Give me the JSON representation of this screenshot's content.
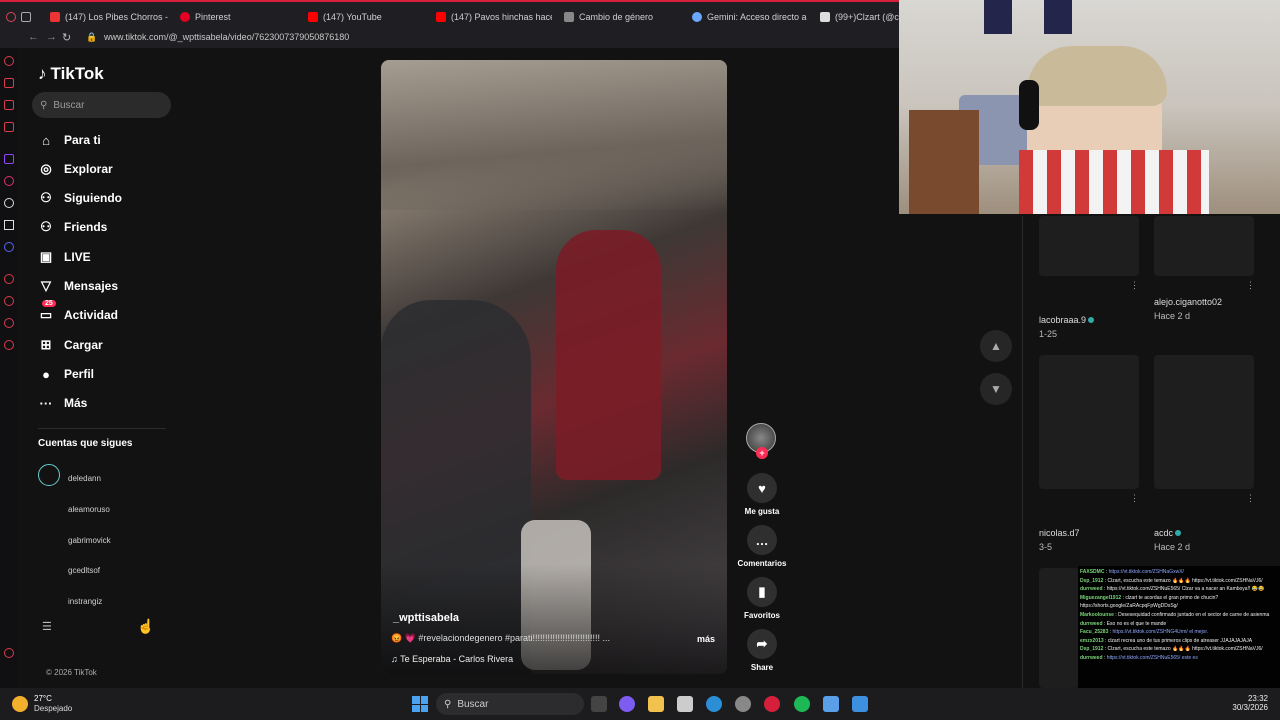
{
  "browser": {
    "tabs": [
      {
        "label": "(147) Los Pibes Chorros -",
        "color": "#e33"
      },
      {
        "label": "Pinterest",
        "color": "#e60023"
      },
      {
        "label": "(147) YouTube",
        "color": "#f00"
      },
      {
        "label": "(147) Pavos hinchas hace",
        "color": "#f00"
      },
      {
        "label": "Cambio de género",
        "color": "#888"
      },
      {
        "label": "Gemini: Acceso directo a",
        "color": "#6aa7ff"
      },
      {
        "label": "(99+)Clzart (@cl",
        "color": "#ddd"
      }
    ],
    "url": "www.tiktok.com/@_wpttisabela/video/7623007379050876180"
  },
  "tiktok": {
    "logo": "TikTok",
    "search_placeholder": "Buscar",
    "nav": [
      {
        "label": "Para ti",
        "icon": "home-icon",
        "glyph": "⌂"
      },
      {
        "label": "Explorar",
        "icon": "compass-icon",
        "glyph": "◎"
      },
      {
        "label": "Siguiendo",
        "icon": "following-icon",
        "glyph": "⚇"
      },
      {
        "label": "Friends",
        "icon": "friends-icon",
        "glyph": "⚇"
      },
      {
        "label": "LIVE",
        "icon": "live-icon",
        "glyph": "▣"
      },
      {
        "label": "Mensajes",
        "icon": "messages-icon",
        "glyph": "▽"
      },
      {
        "label": "Actividad",
        "icon": "activity-icon",
        "glyph": "▭",
        "badge": "25"
      },
      {
        "label": "Cargar",
        "icon": "upload-icon",
        "glyph": "⊞"
      },
      {
        "label": "Perfil",
        "icon": "profile-icon",
        "glyph": "●"
      },
      {
        "label": "Más",
        "icon": "more-icon",
        "glyph": "···"
      }
    ],
    "following_title": "Cuentas que sigues",
    "following": [
      "deledann",
      "aleamoruso",
      "gabrimovick",
      "gcedltsof",
      "instrangiz"
    ],
    "copyright": "© 2026 TikTok"
  },
  "video": {
    "username": "_wpttisabela",
    "description": "😡 💗 #revelaciondegenero #parati!!!!!!!!!!!!!!!!!!!!!!!!!!! ...",
    "more": "más",
    "music": "Te Esperaba - Carlos Rivera",
    "actions": {
      "like": "Me gusta",
      "comment": "Comentarios",
      "favorite": "Favoritos",
      "share": "Share"
    }
  },
  "grid": {
    "row1": [
      {
        "user": "lacobraaa.9",
        "meta": "1-25"
      },
      {
        "user": "alejo.ciganotto02",
        "meta": "Hace 2 d"
      }
    ],
    "row2": [
      {
        "user": "nicolas.d7",
        "meta": "3-5"
      },
      {
        "user": "acdc",
        "meta": "Hace 2 d"
      }
    ]
  },
  "chat": [
    {
      "user": "FAXSDMC",
      "text": "https://vt.tiktok.com/ZSHNaGxwX/"
    },
    {
      "user": "Dsp_1912",
      "text": "Clzart, escucha este temazo 🔥🔥🔥 https://vt.tiktok.com/ZSHNaVJ6/"
    },
    {
      "user": "durrweed",
      "text": "https://vt.tiktok.com/ZSHNuE565/ Clzar va a nacer an Kamboya!! 😂😂"
    },
    {
      "user": "Miguezangel1912",
      "text": "clzart te acordas el gran primo de chucin? https://shorts.google/ZaRAcpqFpWgDDsSg/"
    },
    {
      "user": "Markoolounse",
      "text": "Desesequidad confirmado juntado en el sector de carne de asienma"
    },
    {
      "user": "durrweed",
      "text": "Eso no es el que te mande"
    },
    {
      "user": "Facu_25283",
      "text": "https://vt.tiktok.com/ZSHNG4Urm/ el mejor."
    },
    {
      "user": "emzx2013",
      "text": "clzart recrea uno de tus primeros clips de atreaser JJAJAJAJAJA"
    },
    {
      "user": "Dsp_1912",
      "text": "Clzart, escucha este temazo 🔥🔥🔥 https://vt.tiktok.com/ZSHNaVJ6/"
    },
    {
      "user": "durrweed",
      "text": "https://vt.tiktok.com/ZSHNuE565/ este es"
    }
  ],
  "taskbar": {
    "temp": "27°C",
    "weather": "Despejado",
    "search": "Buscar",
    "time": "23:32",
    "date": "30/3/2026"
  }
}
